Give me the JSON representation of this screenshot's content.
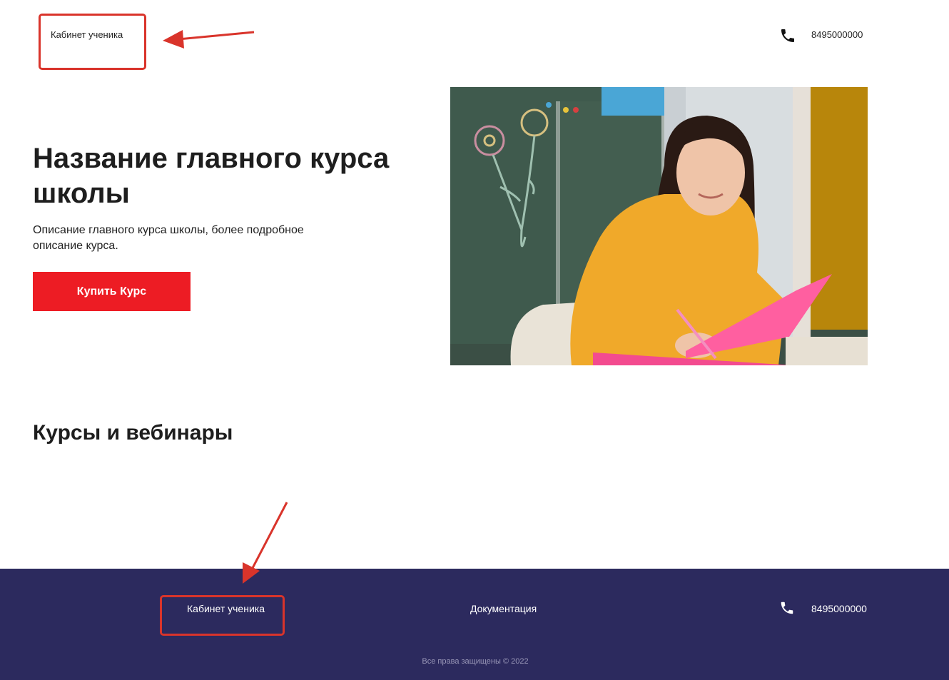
{
  "header": {
    "cabinet_link": "Кабинет ученика",
    "phone": "8495000000",
    "phone_icon": "phone-icon"
  },
  "hero": {
    "title": "Название главного курса школы",
    "description": "Описание главного курса школы, более подробное описание курса.",
    "buy_button": "Купить Курс"
  },
  "courses": {
    "title": "Курсы и вебинары"
  },
  "footer": {
    "cabinet_link": "Кабинет ученика",
    "docs_link": "Документация",
    "phone": "8495000000",
    "phone_icon": "phone-icon",
    "copyright": "Все права защищены © 2022",
    "background": "#2c2a5e"
  },
  "colors": {
    "accent": "#ed1c24",
    "annotation": "#d9342b"
  }
}
